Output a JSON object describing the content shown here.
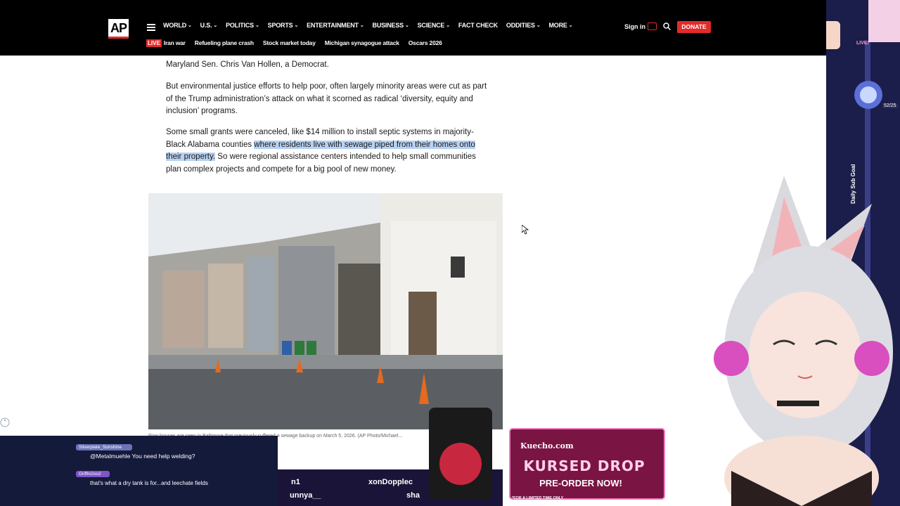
{
  "nav": {
    "logo": "AP",
    "items": [
      "WORLD",
      "U.S.",
      "POLITICS",
      "SPORTS",
      "ENTERTAINMENT",
      "BUSINESS",
      "SCIENCE",
      "FACT CHECK",
      "ODDITIES",
      "MORE"
    ],
    "has_dropdown": [
      true,
      true,
      true,
      true,
      true,
      true,
      true,
      false,
      true,
      true
    ],
    "sign_in": "Sign in",
    "donate": "DONATE",
    "live_badge": "LIVE",
    "trending": [
      "Iran war",
      "Refueling plane crash",
      "Stock market today",
      "Michigan synagogue attack",
      "Oscars 2026"
    ]
  },
  "article": {
    "para0_line2": "Maryland Sen. Chris Van Hollen, a Democrat.",
    "para1": "But environmental justice efforts to help poor, often largely minority areas were cut as part of the Trump administration’s attack on what it scorned as radical ‘diversity, equity and inclusion’ programs.",
    "para2_before": "Some small grants were canceled, like $14 million to install septic systems in majority-Black Alabama counties ",
    "para2_highlight": "where residents live with sewage piped from their homes onto their property.",
    "para2_after": " So were regional assistance centers intended to help small communities plan complex projects and compete for a big pool of new money.",
    "caption": "Row houses are seen in Baltimore that previously suffered a sewage backup on March 5, 2026. (AP Photo/Michael..."
  },
  "stream": {
    "chat": [
      {
        "user": "Silverplate_Sunshine",
        "message": "@Metalmuehle You need help welding?"
      },
      {
        "user": "Griffin2oo2",
        "message": "that's what a dry tank is for...and leechate fields"
      }
    ],
    "bar_names": [
      "n1",
      "xonDopplec",
      "unnya__",
      "sha"
    ],
    "merch_site": "Kuecho.com",
    "merch_title": "KURSED DROP",
    "merch_cta": "PRE-ORDER NOW!",
    "merch_limited": "*FOR A LIMITED TIME ONLY",
    "sub_goal_label": "Daily Sub Goal",
    "sub_goal_count": "52/25",
    "live_label": "LIVE!"
  },
  "colors": {
    "ap_red": "#e32b2b",
    "highlight": "#b7d1f3",
    "nav_bg": "#000000"
  }
}
